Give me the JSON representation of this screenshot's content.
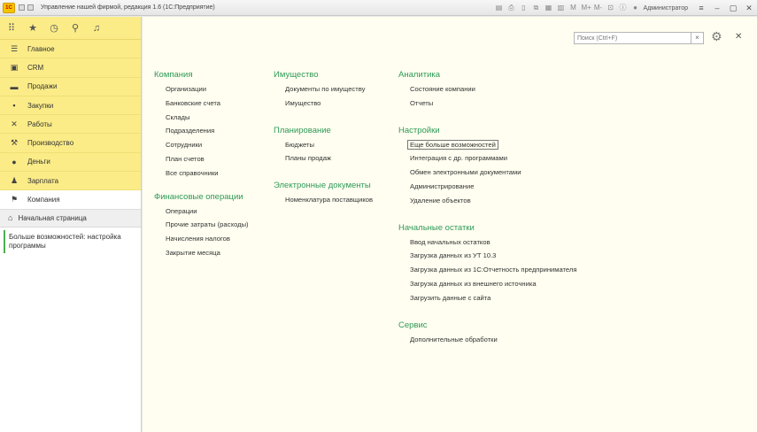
{
  "window": {
    "logo": "1С",
    "title": "Управление нашей фирмой, редакция 1.6  (1С:Предприятие)",
    "user": "Администратор"
  },
  "sidebar": {
    "sections": [
      {
        "label": "Главное",
        "icon": "list-icon"
      },
      {
        "label": "CRM",
        "icon": "crm-icon"
      },
      {
        "label": "Продажи",
        "icon": "cart-icon"
      },
      {
        "label": "Закупки",
        "icon": "box-icon"
      },
      {
        "label": "Работы",
        "icon": "tools-icon"
      },
      {
        "label": "Производство",
        "icon": "factory-icon"
      },
      {
        "label": "Деньги",
        "icon": "money-icon"
      },
      {
        "label": "Зарплата",
        "icon": "people-icon"
      },
      {
        "label": "Компания",
        "icon": "flag-icon"
      }
    ],
    "home": "Начальная страница",
    "open_document": "Больше возможностей: настройка программы"
  },
  "main": {
    "search_placeholder": "Поиск (Ctrl+F)",
    "groups": {
      "company": {
        "title": "Компания",
        "items": [
          "Организации",
          "Банковские счета",
          "Склады",
          "Подразделения",
          "Сотрудники",
          "План счетов",
          "Все справочники"
        ]
      },
      "finance": {
        "title": "Финансовые операции",
        "items": [
          "Операции",
          "Прочие затраты (расходы)",
          "Начисления налогов",
          "Закрытие месяца"
        ]
      },
      "property": {
        "title": "Имущество",
        "items": [
          "Документы по имуществу",
          "Имущество"
        ]
      },
      "planning": {
        "title": "Планирование",
        "items": [
          "Бюджеты",
          "Планы продаж"
        ]
      },
      "edocs": {
        "title": "Электронные документы",
        "items": [
          "Номенклатура поставщиков"
        ]
      },
      "analytics": {
        "title": "Аналитика",
        "items": [
          "Состояние компании",
          "Отчеты"
        ]
      },
      "settings": {
        "title": "Настройки",
        "items": [
          "Еще больше возможностей",
          "Интеграция с др. программами",
          "Обмен электронными документами",
          "Администрирование",
          "Удаление объектов"
        ]
      },
      "initial": {
        "title": "Начальные остатки",
        "items": [
          "Ввод начальных остатков",
          "Загрузка данных из УТ 10.3",
          "Загрузка данных из 1С:Отчетность предпринимателя",
          "Загрузка данных из внешнего источника",
          "Загрузить данные с сайта"
        ]
      },
      "service": {
        "title": "Сервис",
        "items": [
          "Дополнительные обработки"
        ]
      }
    }
  }
}
